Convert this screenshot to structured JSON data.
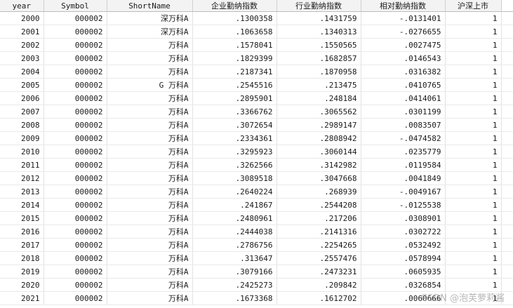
{
  "headers": [
    "year",
    "Symbol",
    "ShortName",
    "企业勤纳指数",
    "行业勤纳指数",
    "相对勤纳指数",
    "沪深上市"
  ],
  "rows": [
    [
      "2000",
      "000002",
      "深万科A",
      ".1300358",
      ".1431759",
      "-.0131401",
      "1"
    ],
    [
      "2001",
      "000002",
      "深万科A",
      ".1063658",
      ".1340313",
      "-.0276655",
      "1"
    ],
    [
      "2002",
      "000002",
      "万科A",
      ".1578041",
      ".1550565",
      ".0027475",
      "1"
    ],
    [
      "2003",
      "000002",
      "万科A",
      ".1829399",
      ".1682857",
      ".0146543",
      "1"
    ],
    [
      "2004",
      "000002",
      "万科A",
      ".2187341",
      ".1870958",
      ".0316382",
      "1"
    ],
    [
      "2005",
      "000002",
      "G 万科A",
      ".2545516",
      ".213475",
      ".0410765",
      "1"
    ],
    [
      "2006",
      "000002",
      "万科A",
      ".2895901",
      ".248184",
      ".0414061",
      "1"
    ],
    [
      "2007",
      "000002",
      "万科A",
      ".3366762",
      ".3065562",
      ".0301199",
      "1"
    ],
    [
      "2008",
      "000002",
      "万科A",
      ".3072654",
      ".2989147",
      ".0083507",
      "1"
    ],
    [
      "2009",
      "000002",
      "万科A",
      ".2334361",
      ".2808942",
      "-.0474582",
      "1"
    ],
    [
      "2010",
      "000002",
      "万科A",
      ".3295923",
      ".3060144",
      ".0235779",
      "1"
    ],
    [
      "2011",
      "000002",
      "万科A",
      ".3262566",
      ".3142982",
      ".0119584",
      "1"
    ],
    [
      "2012",
      "000002",
      "万科A",
      ".3089518",
      ".3047668",
      ".0041849",
      "1"
    ],
    [
      "2013",
      "000002",
      "万科A",
      ".2640224",
      ".268939",
      "-.0049167",
      "1"
    ],
    [
      "2014",
      "000002",
      "万科A",
      ".241867",
      ".2544208",
      "-.0125538",
      "1"
    ],
    [
      "2015",
      "000002",
      "万科A",
      ".2480961",
      ".217206",
      ".0308901",
      "1"
    ],
    [
      "2016",
      "000002",
      "万科A",
      ".2444038",
      ".2141316",
      ".0302722",
      "1"
    ],
    [
      "2017",
      "000002",
      "万科A",
      ".2786756",
      ".2254265",
      ".0532492",
      "1"
    ],
    [
      "2018",
      "000002",
      "万科A",
      ".313647",
      ".2557476",
      ".0578994",
      "1"
    ],
    [
      "2019",
      "000002",
      "万科A",
      ".3079166",
      ".2473231",
      ".0605935",
      "1"
    ],
    [
      "2020",
      "000002",
      "万科A",
      ".2425273",
      ".209842",
      ".0326854",
      "1"
    ],
    [
      "2021",
      "000002",
      "万科A",
      ".1673368",
      ".1612702",
      ".0060666",
      "1"
    ]
  ],
  "watermark": "CSDN @泡芙萝莉酱"
}
